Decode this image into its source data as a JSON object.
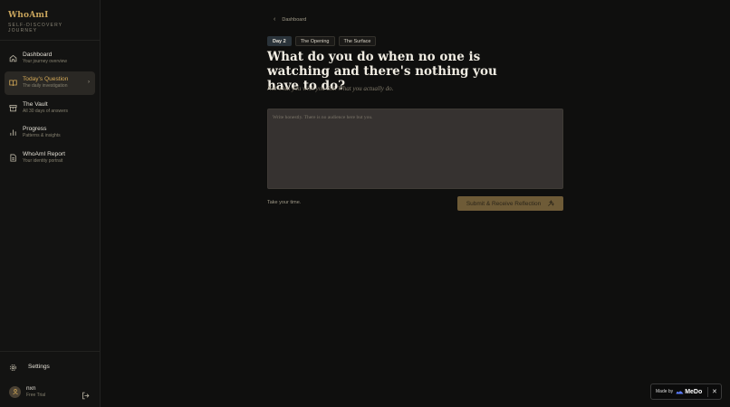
{
  "brand": {
    "title": "WhoAmI",
    "subtitle": "SELF-DISCOVERY JOURNEY"
  },
  "nav": [
    {
      "label": "Dashboard",
      "desc": "Your journey overview",
      "icon": "home-icon"
    },
    {
      "label": "Today's Question",
      "desc": "The daily investigation",
      "icon": "book-icon",
      "active": true
    },
    {
      "label": "The Vault",
      "desc": "All 30 days of answers",
      "icon": "archive-icon"
    },
    {
      "label": "Progress",
      "desc": "Patterns & insights",
      "icon": "chart-icon"
    },
    {
      "label": "WhoAmI Report",
      "desc": "Your identity portrait",
      "icon": "document-icon"
    }
  ],
  "settings": {
    "label": "Settings"
  },
  "user": {
    "name": "nxn",
    "plan": "Free Trial",
    "initials": ""
  },
  "breadcrumb": {
    "label": "Dashboard"
  },
  "tags": [
    "Day 2",
    "The Opening",
    "The Surface"
  ],
  "question": "What do you do when no one is watching and there's nothing you have to do?",
  "subquestion": "Not what you wish you did. What you actually do.",
  "answer": {
    "placeholder": "Write honestly. There is no audience here but you.",
    "value": ""
  },
  "hint": "Take your time.",
  "submit": {
    "label": "Submit & Receive Reflection"
  },
  "badge": {
    "prefix": "Made by",
    "brand": "MeDo"
  },
  "colors": {
    "accent": "#d4a957",
    "background": "#0f0f0e",
    "sidebar": "#131312",
    "submit_bg": "#6e5b37"
  }
}
